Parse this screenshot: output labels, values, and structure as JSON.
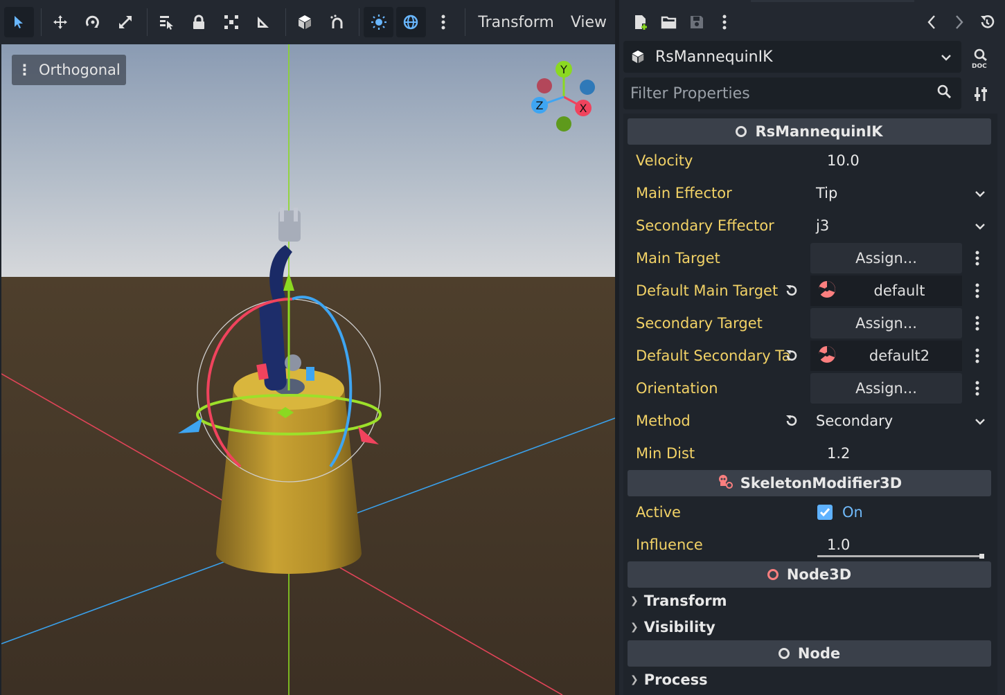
{
  "toolbar": {
    "tools": [
      {
        "icon": "select-arrow-icon",
        "active": true
      },
      {
        "icon": "move-icon"
      },
      {
        "icon": "rotate-icon"
      },
      {
        "icon": "scale-icon"
      },
      {
        "icon": "list-select-icon"
      },
      {
        "icon": "lock-icon"
      },
      {
        "icon": "group-icon"
      },
      {
        "icon": "ruler-icon"
      },
      {
        "icon": "local-space-icon"
      },
      {
        "icon": "snap-icon"
      },
      {
        "icon": "sun-icon",
        "active": true
      },
      {
        "icon": "environment-icon",
        "active": true
      },
      {
        "icon": "more-icon"
      }
    ],
    "menu_transform": "Transform",
    "menu_view": "View"
  },
  "viewport": {
    "mode_label": "Orthogonal",
    "gizmo": {
      "y": "Y",
      "x": "X",
      "z": "Z"
    }
  },
  "inspector": {
    "node_name": "RsMannequinIK",
    "filter_placeholder": "Filter Properties",
    "sections": {
      "main": "RsMannequinIK",
      "skeleton_modifier": "SkeletonModifier3D",
      "node3d": "Node3D",
      "node": "Node"
    },
    "props": {
      "velocity": {
        "label": "Velocity",
        "value": "10.0"
      },
      "main_effector": {
        "label": "Main Effector",
        "value": "Tip"
      },
      "secondary_effector": {
        "label": "Secondary Effector",
        "value": "j3"
      },
      "main_target": {
        "label": "Main Target",
        "value": "Assign..."
      },
      "default_main_target": {
        "label": "Default Main Target",
        "value": "default"
      },
      "secondary_target": {
        "label": "Secondary Target",
        "value": "Assign..."
      },
      "default_secondary_target": {
        "label": "Default Secondary Ta",
        "value": "default2"
      },
      "orientation": {
        "label": "Orientation",
        "value": "Assign..."
      },
      "method": {
        "label": "Method",
        "value": "Secondary"
      },
      "min_dist": {
        "label": "Min Dist",
        "value": "1.2"
      },
      "active": {
        "label": "Active",
        "value": "On"
      },
      "influence": {
        "label": "Influence",
        "value": "1.0"
      }
    },
    "groups": {
      "transform": "Transform",
      "visibility": "Visibility",
      "process": "Process"
    }
  },
  "colors": {
    "property_label": "#f2d266",
    "accent": "#5fb2ff",
    "axis_x": "#f0435d",
    "axis_y": "#8bd921",
    "axis_z": "#3ea5f2"
  }
}
